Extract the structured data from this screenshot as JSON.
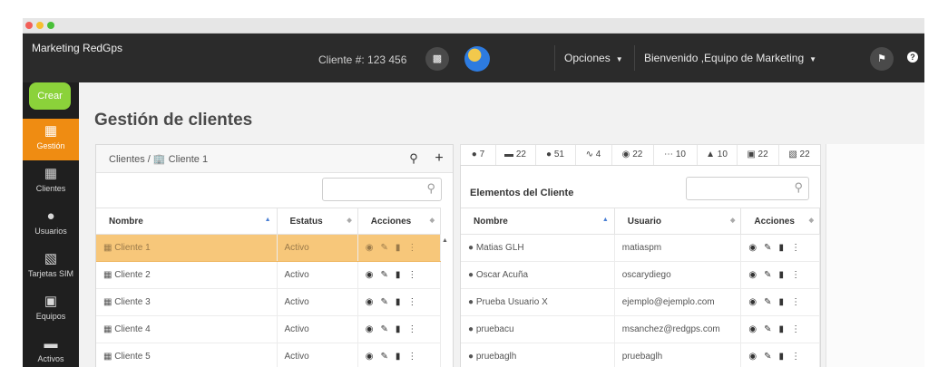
{
  "app": {
    "brand": "Marketing RedGps"
  },
  "topnav": {
    "cliente_text": "Cliente #: 123 456",
    "opciones": "Opciones",
    "bienvenido": "Bienvenido ,Equipo de Marketing"
  },
  "sidebar": {
    "create": "Crear",
    "items": [
      {
        "label": "Gestión",
        "icon": "building-icon"
      },
      {
        "label": "Clientes",
        "icon": "buildings-icon"
      },
      {
        "label": "Usuarios",
        "icon": "user-icon"
      },
      {
        "label": "Tarjetas SIM",
        "icon": "sim-card-icon"
      },
      {
        "label": "Equipos",
        "icon": "device-icon"
      },
      {
        "label": "Activos",
        "icon": "car-icon"
      }
    ]
  },
  "page": {
    "title": "Gestión de clientes"
  },
  "left_panel": {
    "breadcrumb": "Clientes / 🏢 Cliente 1",
    "columns": [
      "Nombre",
      "Estatus",
      "Acciones"
    ],
    "rows": [
      {
        "name": "Cliente 1",
        "status": "Activo",
        "selected": true
      },
      {
        "name": "Cliente 2",
        "status": "Activo",
        "selected": false
      },
      {
        "name": "Cliente 3",
        "status": "Activo",
        "selected": false
      },
      {
        "name": "Cliente 4",
        "status": "Activo",
        "selected": false
      },
      {
        "name": "Cliente 5",
        "status": "Activo",
        "selected": false
      }
    ]
  },
  "right_panel": {
    "tabs": [
      {
        "icon": "user-icon",
        "count": "7"
      },
      {
        "icon": "car-icon",
        "count": "22"
      },
      {
        "icon": "pin-icon",
        "count": "51"
      },
      {
        "icon": "route-icon",
        "count": "4"
      },
      {
        "icon": "gauge-icon",
        "count": "22"
      },
      {
        "icon": "dots-icon",
        "count": "10"
      },
      {
        "icon": "warning-icon",
        "count": "10"
      },
      {
        "icon": "screen-icon",
        "count": "22"
      },
      {
        "icon": "doc-icon",
        "count": "22"
      }
    ],
    "title": "Elementos del Cliente",
    "columns": [
      "Nombre",
      "Usuario",
      "Acciones"
    ],
    "rows": [
      {
        "name": "Matias GLH",
        "user": "matiaspm"
      },
      {
        "name": "Oscar Acuña",
        "user": "oscarydiego"
      },
      {
        "name": "Prueba Usuario X",
        "user": "ejemplo@ejemplo.com"
      },
      {
        "name": "pruebacu",
        "user": "msanchez@redgps.com"
      },
      {
        "name": "pruebaglh",
        "user": "pruebaglh"
      }
    ]
  }
}
